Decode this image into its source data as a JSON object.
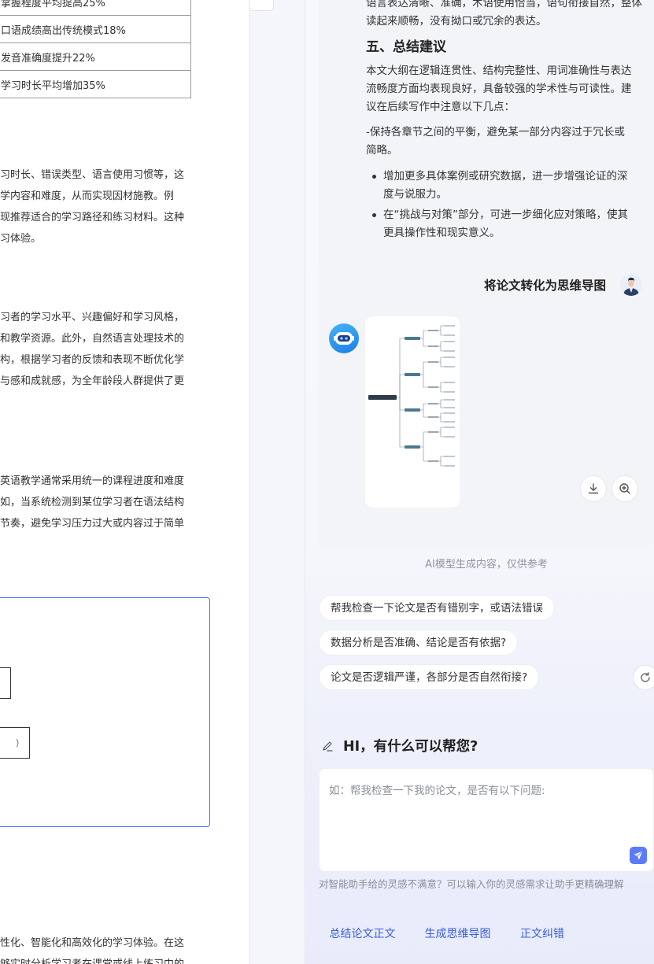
{
  "document": {
    "table_rows": [
      "掌握程度平均提高25%",
      "口语成绩高出传统模式18%",
      "发音准确度提升22%",
      "学习时长平均增加35%"
    ],
    "paragraphs": [
      [
        "习时长、错误类型、语言使用习惯等，这",
        "学内容和难度，从而实现因材施教。例",
        "现推荐适合的学习路径和练习材料。这种",
        "习体验。"
      ],
      [
        "习者的学习水平、兴趣偏好和学习风格，",
        "和教学资源。此外，自然语言处理技术的",
        "构，根据学习者的反馈和表现不断优化学",
        "与感和成就感，为全年龄段人群提供了更"
      ],
      [
        "英语教学通常采用统一的课程进度和难度",
        "如，当系统检测到某位学习者在语法结构",
        "节奏，避免学习压力过大或内容过于简单"
      ],
      [
        "性化、智能化和高效化的学习体验。在这",
        "够实时分析学习者在课堂或线上练习中的"
      ]
    ],
    "figure": {
      "node_text": "）"
    }
  },
  "assistant": {
    "intro_lines": [
      "语言表达清晰、准确，术语使用恰当，语句衔接自然，整体",
      "读起来顺畅，没有拗口或冗余的表达。"
    ],
    "section_title": "五、总结建议",
    "summary_lines": [
      "本文大纲在逻辑连贯性、结构完整性、用词准确性与表达",
      "流畅度方面均表现良好，具备较强的学术性与可读性。建",
      "议在后续写作中注意以下几点："
    ],
    "dash_lines": [
      "-保持各章节之间的平衡，避免某一部分内容过于冗长或",
      "简略。"
    ],
    "bullets": [
      [
        "增加更多具体案例或研究数据，进一步增强论证的深",
        "度与说服力。"
      ],
      [
        "在“挑战与对策”部分，可进一步细化应对策略，使其",
        "更具操作性和现实意义。"
      ]
    ],
    "user_message": "将论文转化为思维导图",
    "disclaimer": "AI模型生成内容，仅供参考",
    "suggestions": [
      "帮我检查一下论文是否有错别字，或语法错误",
      "数据分析是否准确、结论是否有依据?",
      "论文是否逻辑严谨，各部分是否自然衔接?"
    ],
    "greeting": "HI，有什么可以帮您?",
    "input": {
      "placeholder": "如：帮我检查一下我的论文，是否有以下问题:",
      "value": ""
    },
    "hint": "对智能助手给的灵感不满意？可以输入你的灵感需求让助手更精确理解",
    "actions": [
      "总结论文正文",
      "生成思维导图",
      "正文纠错"
    ],
    "icons": {
      "download": "download-icon",
      "zoom": "zoom-in-icon",
      "refresh": "refresh-icon",
      "pen": "pen-icon",
      "send": "send-icon"
    },
    "colors": {
      "accent": "#5b7cf6",
      "action_bg": "#e8ecfb",
      "action_text": "#3b5bdb",
      "figure_border": "#4a6ff0"
    }
  }
}
